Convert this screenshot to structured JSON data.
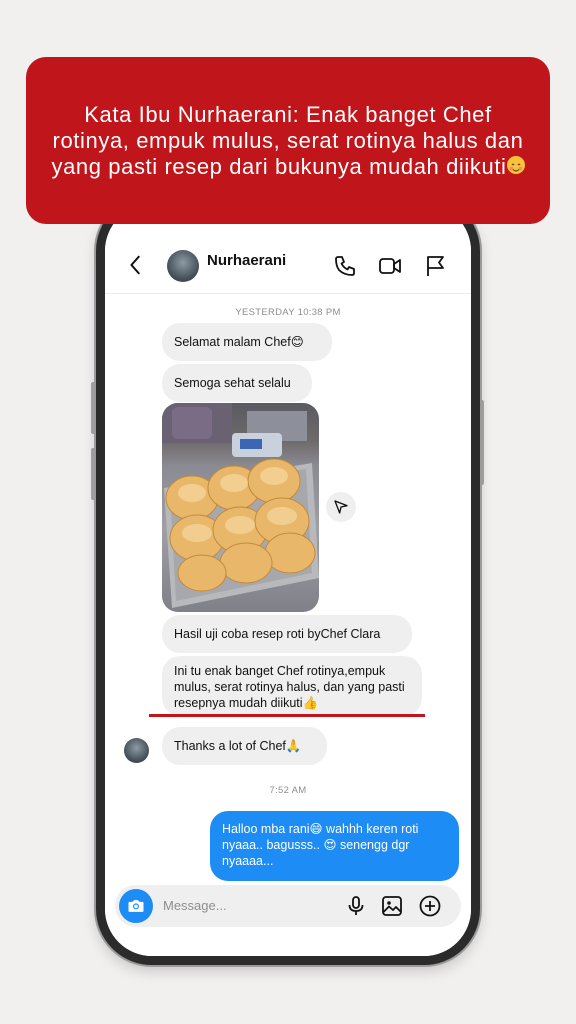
{
  "banner": {
    "text": "Kata Ibu Nurhaerani: Enak banget Chef rotinya, empuk mulus, serat rotinya halus dan yang pasti resep dari bukunya mudah diikuti"
  },
  "header": {
    "name": "Nurhaerani",
    "icons": [
      "back-chevron-icon",
      "phone-icon",
      "video-icon",
      "flag-icon"
    ]
  },
  "messages": {
    "timestamp_1": "YESTERDAY 10:38 PM",
    "m1": "Selamat malam Chef😊",
    "m2": "Semoga sehat selalu",
    "m3": "Hasil uji coba resep roti byChef Clara",
    "m4": "Ini tu enak banget Chef rotinya,empuk mulus, serat rotinya halus, dan yang pasti resepnya mudah diikuti👍",
    "m5": "Thanks a lot of Chef🙏",
    "timestamp_2": "7:52 AM",
    "m6": "Halloo mba rani😄  wahhh keren roti nyaaa.. bagusss.. 😍 senengg dgr nyaaaa..."
  },
  "composer": {
    "placeholder": "Message..."
  },
  "colors": {
    "banner": "#c0151a",
    "sent_bubble": "#1e8cf5",
    "received_bubble": "#efefef"
  }
}
